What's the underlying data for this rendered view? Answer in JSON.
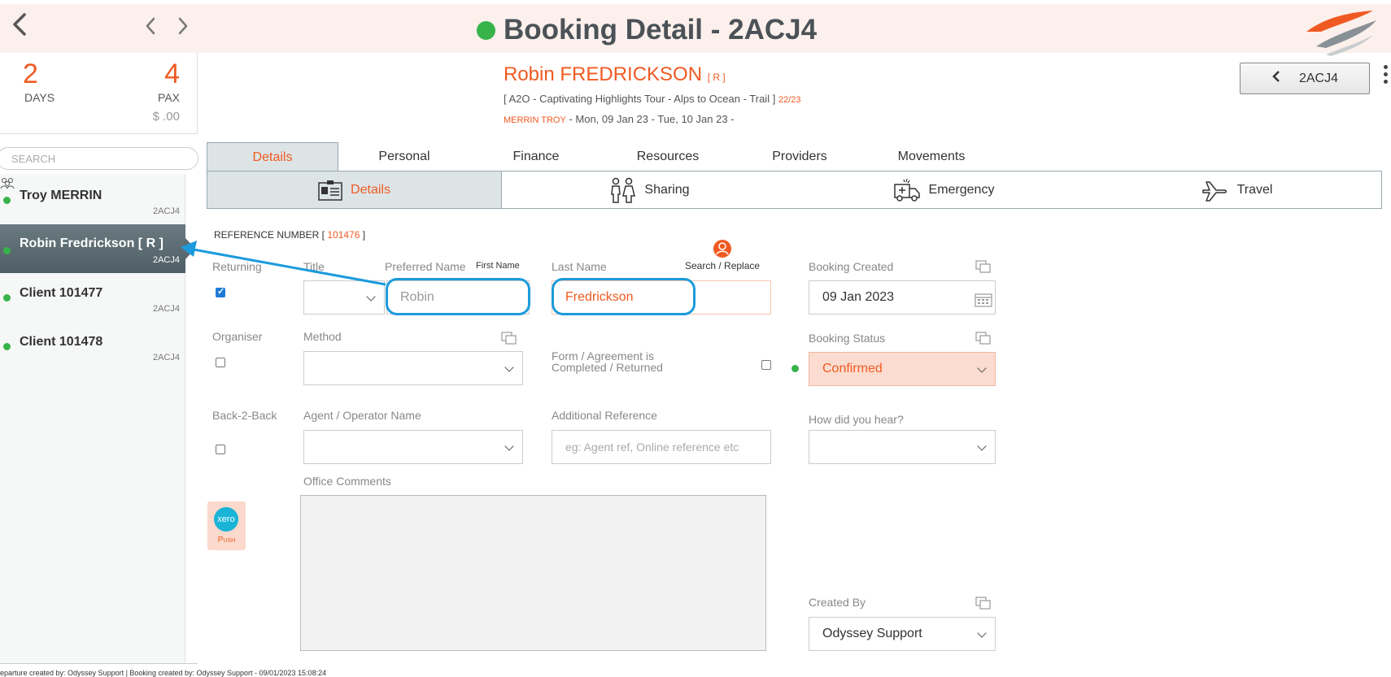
{
  "header": {
    "title": "Booking Detail - 2ACJ4"
  },
  "summary": {
    "days_value": "2",
    "days_label": "DAYS",
    "pax_value": "4",
    "pax_label": "PAX",
    "amount": "$ .00"
  },
  "search": {
    "placeholder": "SEARCH"
  },
  "clients": [
    {
      "name": "Troy MERRIN",
      "code": "2ACJ4",
      "active": false
    },
    {
      "name": "Robin Fredrickson  [ R ]",
      "code": "2ACJ4",
      "active": true
    },
    {
      "name": "Client 101477",
      "code": "2ACJ4",
      "active": false
    },
    {
      "name": "Client 101478",
      "code": "2ACJ4",
      "active": false
    }
  ],
  "booking": {
    "client_name": "Robin FREDRICKSON",
    "client_tag": "[ R ]",
    "tour_text": "[ A2O - Captivating Highlights Tour - Alps to Ocean - Trail ]",
    "tour_code": "22/23",
    "lead_name": "MERRIN TROY",
    "dates": " - Mon, 09 Jan 23 - Tue, 10 Jan 23 -",
    "booking_button": "2ACJ4"
  },
  "tabs": [
    "Details",
    "Personal",
    "Finance",
    "Resources",
    "Providers",
    "Movements"
  ],
  "subtabs": [
    "Details",
    "Sharing",
    "Emergency",
    "Travel"
  ],
  "form": {
    "reference_prefix": "REFERENCE NUMBER [",
    "reference_number": "101476",
    "reference_suffix": "]",
    "returning_label": "Returning",
    "returning_checked": true,
    "title_label": "Title",
    "preferred_name_label": "Preferred Name",
    "first_name_label": "First Name",
    "preferred_name_value": "Robin",
    "last_name_label": "Last Name",
    "search_replace_label": "Search / Replace",
    "last_name_value": "Fredrickson",
    "booking_created_label": "Booking Created",
    "booking_created_value": "09 Jan 2023",
    "organiser_label": "Organiser",
    "method_label": "Method",
    "form_agreement_label_1": "Form / Agreement is",
    "form_agreement_label_2": "Completed / Returned",
    "booking_status_label": "Booking Status",
    "booking_status_value": "Confirmed",
    "back2back_label": "Back-2-Back",
    "agent_label": "Agent / Operator Name",
    "additional_ref_label": "Additional Reference",
    "additional_ref_placeholder": "eg: Agent ref, Online reference etc",
    "how_hear_label": "How did you hear?",
    "office_comments_label": "Office Comments",
    "created_by_label": "Created By",
    "created_by_value": "Odyssey Support",
    "xero_label": "xero",
    "push_label": "Push"
  },
  "footer": {
    "text": "eparture created by: Odyssey Support | Booking created by: Odyssey Support - 09/01/2023 15:08:24"
  },
  "colors": {
    "accent": "#f05a22",
    "status_green": "#37b34a",
    "highlight_blue": "#1b9bdc",
    "header_bg": "#fcf0ec"
  }
}
